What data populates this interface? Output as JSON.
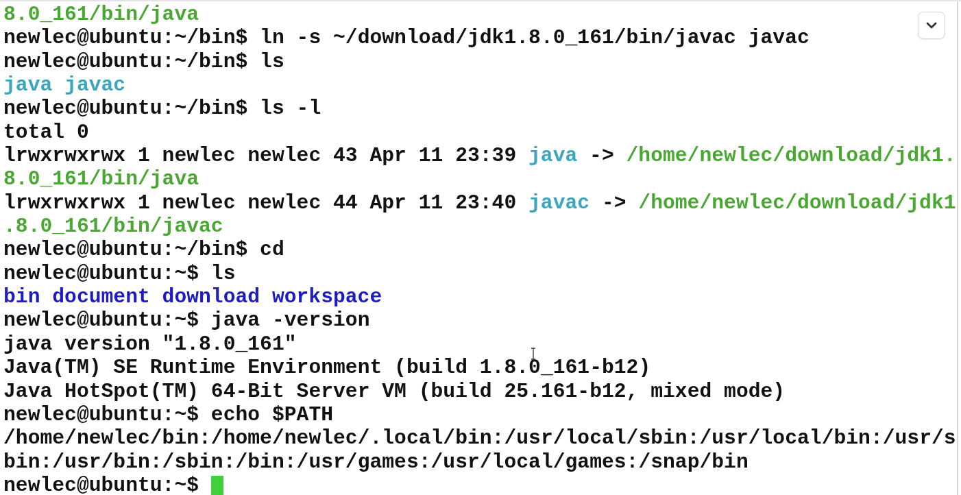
{
  "terminal": {
    "lines": [
      [
        {
          "text": "8.0_161/bin/java",
          "kind": "path"
        }
      ],
      [
        {
          "text": "newlec@ubuntu:~/bin$ ln -s ~/download/jdk1.8.0_161/bin/javac javac",
          "kind": "plain"
        }
      ],
      [
        {
          "text": "newlec@ubuntu:~/bin$ ls",
          "kind": "plain"
        }
      ],
      [
        {
          "text": "java",
          "kind": "link"
        },
        {
          "text": "javac",
          "kind": "link"
        }
      ],
      [
        {
          "text": "newlec@ubuntu:~/bin$ ls -l",
          "kind": "plain"
        }
      ],
      [
        {
          "text": "total 0",
          "kind": "plain"
        }
      ],
      [
        {
          "text": "lrwxrwxrwx 1 newlec newlec 43 Apr 11 23:39",
          "kind": "plain"
        },
        {
          "text": "java",
          "kind": "link"
        },
        {
          "text": "->",
          "kind": "plain"
        },
        {
          "text": "/home/newlec/download/jdk1.",
          "kind": "path"
        }
      ],
      [
        {
          "text": "8.0_161/bin/java",
          "kind": "path"
        }
      ],
      [
        {
          "text": "lrwxrwxrwx 1 newlec newlec 44 Apr 11 23:40",
          "kind": "plain"
        },
        {
          "text": "javac",
          "kind": "link"
        },
        {
          "text": "->",
          "kind": "plain"
        },
        {
          "text": "/home/newlec/download/jdk1",
          "kind": "path"
        }
      ],
      [
        {
          "text": ".8.0_161/bin/javac",
          "kind": "path"
        }
      ],
      [
        {
          "text": "newlec@ubuntu:~/bin$ cd",
          "kind": "plain"
        }
      ],
      [
        {
          "text": "newlec@ubuntu:~$ ls",
          "kind": "plain"
        }
      ],
      [
        {
          "text": "bin",
          "kind": "dir"
        },
        {
          "text": "document",
          "kind": "dir"
        },
        {
          "text": "download",
          "kind": "dir"
        },
        {
          "text": "workspace",
          "kind": "dir"
        }
      ],
      [
        {
          "text": "newlec@ubuntu:~$ java -version",
          "kind": "plain"
        }
      ],
      [
        {
          "text": "java version \"1.8.0_161\"",
          "kind": "plain"
        }
      ],
      [
        {
          "text": "Java(TM) SE Runtime Environment (build 1.8.0_161-b12)",
          "kind": "plain"
        }
      ],
      [
        {
          "text": "Java HotSpot(TM) 64-Bit Server VM (build 25.161-b12, mixed mode)",
          "kind": "plain"
        }
      ],
      [
        {
          "text": "newlec@ubuntu:~$ echo $PATH",
          "kind": "plain"
        }
      ],
      [
        {
          "text": "/home/newlec/bin:/home/newlec/.local/bin:/usr/local/sbin:/usr/local/bin:/usr/s",
          "kind": "plain"
        }
      ],
      [
        {
          "text": "bin:/usr/bin:/sbin:/bin:/usr/games:/usr/local/games:/snap/bin",
          "kind": "plain"
        }
      ],
      [
        {
          "text": "newlec@ubuntu:~$",
          "kind": "plain"
        }
      ]
    ]
  }
}
